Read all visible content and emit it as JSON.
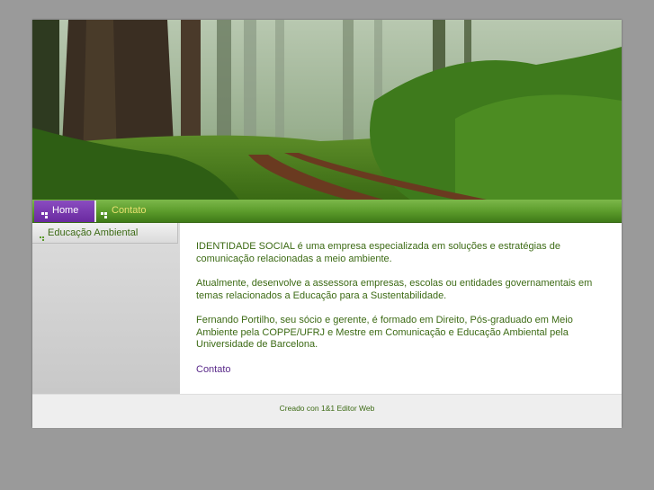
{
  "nav": {
    "items": [
      {
        "label": "Home",
        "active": true
      },
      {
        "label": "Contato",
        "active": false
      }
    ]
  },
  "sidebar": {
    "items": [
      {
        "label": "Educação Ambiental"
      }
    ]
  },
  "content": {
    "paragraphs": [
      "IDENTIDADE SOCIAL é uma empresa especializada em soluções e estratégias de comunicação relacionadas a meio ambiente.",
      "Atualmente, desenvolve a assessora empresas, escolas ou entidades governamentais em temas relacionados a Educação para a Sustentabilidade.",
      "Fernando Portilho, seu sócio e gerente, é formado em Direito, Pós-graduado em Meio Ambiente pela COPPE/UFRJ e Mestre em Comunicação e Educação Ambiental pela Universidade de Barcelona."
    ],
    "contact_link": "Contato"
  },
  "footer": {
    "text": "Creado con 1&1 Editor Web"
  },
  "colors": {
    "nav_green": "#5a9a2a",
    "nav_active_purple": "#6a2aa0",
    "text_green": "#3c6a14",
    "link_purple": "#5a2a8a",
    "nav_inactive_text": "#e8e070"
  },
  "header_image": {
    "subject": "forest-path"
  }
}
